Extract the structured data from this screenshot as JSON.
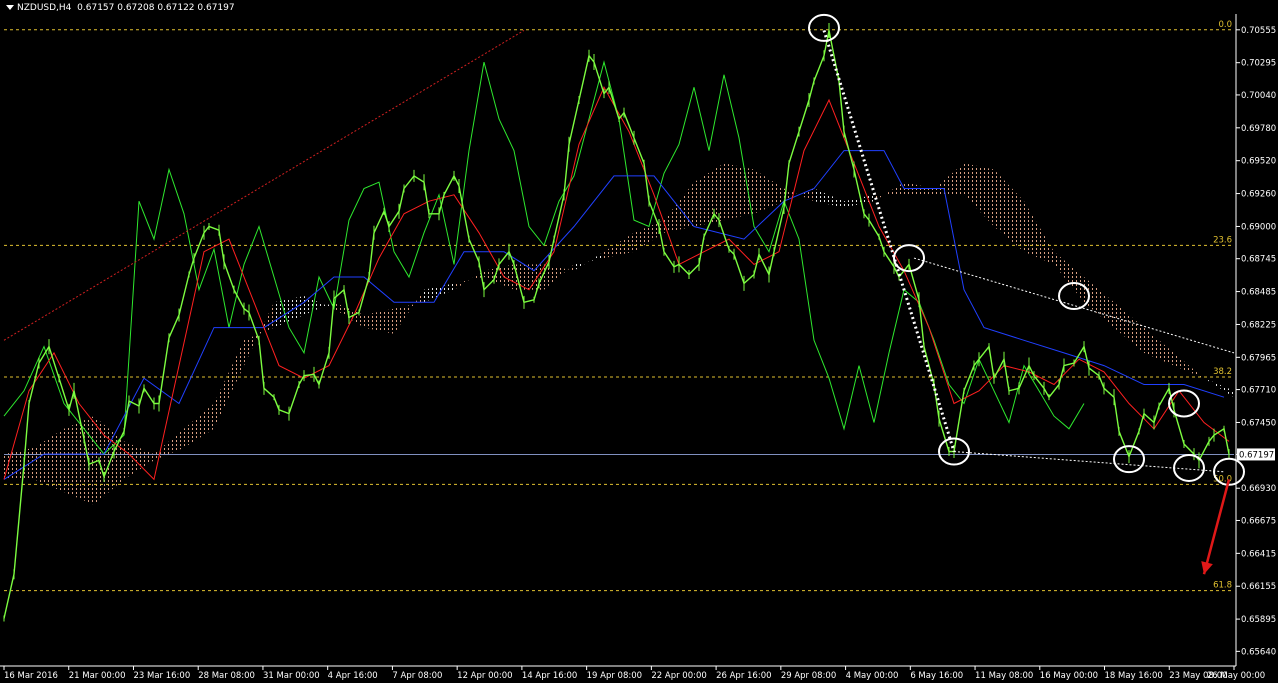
{
  "header": {
    "symbol_timeframe": "NZDUSD,H4",
    "ohlc": "0.67157 0.67208 0.67122 0.67197"
  },
  "colors": {
    "background": "#000000",
    "price_line": "#7cfc40",
    "chikou": "#2ee82e",
    "tenkan": "#ff2020",
    "kijun": "#2040ff",
    "fib_level": "#e0c030",
    "trendline": "#d02020",
    "annotation": "#ffffff",
    "cloud_bull": "#f0b090",
    "cloud_bear": "#ffffff",
    "current_price_line": "#8090c0",
    "arrow": "#e01818"
  },
  "chart_data": {
    "type": "line",
    "title": "",
    "xlabel": "",
    "ylabel": "",
    "ylim": [
      0.6554,
      0.7068
    ],
    "x_ticks": [
      "16 Mar 2016",
      "21 Mar 00:00",
      "23 Mar 16:00",
      "28 Mar 08:00",
      "31 Mar 00:00",
      "4 Apr 16:00",
      "7 Apr 08:00",
      "12 Apr 00:00",
      "14 Apr 16:00",
      "19 Apr 08:00",
      "22 Apr 00:00",
      "26 Apr 16:00",
      "29 Apr 08:00",
      "4 May 00:00",
      "6 May 16:00",
      "11 May 08:00",
      "16 May 00:00",
      "18 May 16:00",
      "23 May 08:00",
      "26 May 00:00"
    ],
    "y_ticks": [
      "0.70555",
      "0.70295",
      "0.70040",
      "0.69780",
      "0.69520",
      "0.69260",
      "0.69000",
      "0.68745",
      "0.68485",
      "0.68225",
      "0.67965",
      "0.67710",
      "0.67450",
      "0.67197",
      "0.66930",
      "0.66675",
      "0.66415",
      "0.66155",
      "0.65895",
      "0.65640"
    ],
    "current_price": 0.67197,
    "current_price_label": "0.67197",
    "fibonacci": [
      {
        "label": "0.0",
        "price": 0.70555
      },
      {
        "label": "23.6",
        "price": 0.6885
      },
      {
        "label": "38.2",
        "price": 0.6781
      },
      {
        "label": "50.0",
        "price": 0.6696
      },
      {
        "label": "61.8",
        "price": 0.6612
      }
    ],
    "price_path": [
      [
        0,
        0.659
      ],
      [
        2,
        0.6625
      ],
      [
        4,
        0.6712
      ],
      [
        5,
        0.676
      ],
      [
        7,
        0.6792
      ],
      [
        9,
        0.6805
      ],
      [
        11,
        0.678
      ],
      [
        13,
        0.6755
      ],
      [
        14,
        0.677
      ],
      [
        16,
        0.6732
      ],
      [
        17,
        0.6712
      ],
      [
        19,
        0.6715
      ],
      [
        20,
        0.6702
      ],
      [
        22,
        0.6722
      ],
      [
        24,
        0.6738
      ],
      [
        25,
        0.6762
      ],
      [
        27,
        0.6758
      ],
      [
        28,
        0.6772
      ],
      [
        30,
        0.676
      ],
      [
        31,
        0.676
      ],
      [
        33,
        0.6812
      ],
      [
        35,
        0.683
      ],
      [
        37,
        0.6862
      ],
      [
        38,
        0.6875
      ],
      [
        40,
        0.6895
      ],
      [
        41,
        0.69
      ],
      [
        43,
        0.6897
      ],
      [
        44,
        0.6872
      ],
      [
        46,
        0.685
      ],
      [
        48,
        0.6835
      ],
      [
        49,
        0.6832
      ],
      [
        51,
        0.681
      ],
      [
        52,
        0.6772
      ],
      [
        54,
        0.6765
      ],
      [
        55,
        0.6755
      ],
      [
        57,
        0.6752
      ],
      [
        59,
        0.6775
      ],
      [
        60,
        0.6782
      ],
      [
        62,
        0.6783
      ],
      [
        63,
        0.6775
      ],
      [
        65,
        0.68
      ],
      [
        66,
        0.6843
      ],
      [
        68,
        0.685
      ],
      [
        69,
        0.6828
      ],
      [
        71,
        0.6832
      ],
      [
        73,
        0.686
      ],
      [
        74,
        0.6895
      ],
      [
        76,
        0.6912
      ],
      [
        77,
        0.69
      ],
      [
        79,
        0.6912
      ],
      [
        80,
        0.693
      ],
      [
        82,
        0.694
      ],
      [
        84,
        0.6935
      ],
      [
        85,
        0.691
      ],
      [
        87,
        0.691
      ],
      [
        88,
        0.6925
      ],
      [
        90,
        0.694
      ],
      [
        91,
        0.6932
      ],
      [
        93,
        0.689
      ],
      [
        95,
        0.6872
      ],
      [
        96,
        0.685
      ],
      [
        98,
        0.6858
      ],
      [
        99,
        0.687
      ],
      [
        101,
        0.688
      ],
      [
        102,
        0.687
      ],
      [
        104,
        0.684
      ],
      [
        106,
        0.6842
      ],
      [
        107,
        0.6855
      ],
      [
        109,
        0.6872
      ],
      [
        110,
        0.689
      ],
      [
        112,
        0.6925
      ],
      [
        113,
        0.6965
      ],
      [
        115,
        0.7
      ],
      [
        117,
        0.7035
      ],
      [
        118,
        0.703
      ],
      [
        120,
        0.7005
      ],
      [
        121,
        0.701
      ],
      [
        123,
        0.6985
      ],
      [
        124,
        0.699
      ],
      [
        126,
        0.697
      ],
      [
        128,
        0.695
      ],
      [
        129,
        0.692
      ],
      [
        131,
        0.69
      ],
      [
        132,
        0.688
      ],
      [
        134,
        0.6868
      ],
      [
        135,
        0.687
      ],
      [
        137,
        0.6862
      ],
      [
        139,
        0.687
      ],
      [
        140,
        0.6892
      ],
      [
        142,
        0.691
      ],
      [
        143,
        0.6905
      ],
      [
        145,
        0.6882
      ],
      [
        146,
        0.6878
      ],
      [
        148,
        0.6855
      ],
      [
        150,
        0.6862
      ],
      [
        151,
        0.6878
      ],
      [
        153,
        0.6862
      ],
      [
        154,
        0.688
      ],
      [
        156,
        0.6915
      ],
      [
        157,
        0.695
      ],
      [
        159,
        0.6975
      ],
      [
        161,
        0.7
      ],
      [
        162,
        0.7015
      ],
      [
        164,
        0.7035
      ],
      [
        165,
        0.7055
      ],
      [
        167,
        0.7015
      ],
      [
        168,
        0.6975
      ],
      [
        170,
        0.6945
      ],
      [
        172,
        0.691
      ],
      [
        173,
        0.6905
      ],
      [
        175,
        0.6892
      ],
      [
        176,
        0.688
      ],
      [
        178,
        0.6868
      ],
      [
        179,
        0.686
      ],
      [
        181,
        0.687
      ],
      [
        183,
        0.6842
      ],
      [
        184,
        0.6805
      ],
      [
        186,
        0.6775
      ],
      [
        187,
        0.6748
      ],
      [
        189,
        0.6722
      ],
      [
        190,
        0.6722
      ],
      [
        192,
        0.677
      ],
      [
        194,
        0.679
      ],
      [
        195,
        0.6795
      ],
      [
        197,
        0.6805
      ],
      [
        198,
        0.678
      ],
      [
        200,
        0.6795
      ],
      [
        201,
        0.677
      ],
      [
        203,
        0.6772
      ],
      [
        205,
        0.679
      ],
      [
        206,
        0.6782
      ],
      [
        208,
        0.6772
      ],
      [
        209,
        0.6765
      ],
      [
        211,
        0.6775
      ],
      [
        212,
        0.679
      ],
      [
        214,
        0.6792
      ],
      [
        216,
        0.6805
      ],
      [
        217,
        0.6788
      ],
      [
        219,
        0.6782
      ],
      [
        220,
        0.6772
      ],
      [
        222,
        0.6765
      ],
      [
        223,
        0.6738
      ],
      [
        225,
        0.6718
      ],
      [
        227,
        0.6738
      ],
      [
        228,
        0.6752
      ],
      [
        230,
        0.6745
      ],
      [
        231,
        0.6758
      ],
      [
        233,
        0.6772
      ],
      [
        234,
        0.6755
      ],
      [
        236,
        0.6728
      ],
      [
        238,
        0.672
      ],
      [
        239,
        0.6715
      ],
      [
        241,
        0.673
      ],
      [
        242,
        0.6735
      ],
      [
        244,
        0.674
      ],
      [
        245,
        0.672
      ]
    ],
    "tenkan": [
      [
        0,
        0.67
      ],
      [
        5,
        0.677
      ],
      [
        10,
        0.68
      ],
      [
        15,
        0.676
      ],
      [
        20,
        0.6735
      ],
      [
        25,
        0.672
      ],
      [
        30,
        0.67
      ],
      [
        35,
        0.679
      ],
      [
        40,
        0.688
      ],
      [
        45,
        0.689
      ],
      [
        50,
        0.684
      ],
      [
        55,
        0.679
      ],
      [
        60,
        0.678
      ],
      [
        65,
        0.679
      ],
      [
        70,
        0.683
      ],
      [
        75,
        0.6875
      ],
      [
        80,
        0.691
      ],
      [
        85,
        0.692
      ],
      [
        90,
        0.6925
      ],
      [
        95,
        0.6895
      ],
      [
        100,
        0.686
      ],
      [
        105,
        0.685
      ],
      [
        110,
        0.688
      ],
      [
        115,
        0.6965
      ],
      [
        120,
        0.701
      ],
      [
        125,
        0.6975
      ],
      [
        130,
        0.6925
      ],
      [
        135,
        0.687
      ],
      [
        140,
        0.688
      ],
      [
        145,
        0.689
      ],
      [
        150,
        0.687
      ],
      [
        155,
        0.688
      ],
      [
        160,
        0.696
      ],
      [
        165,
        0.7
      ],
      [
        170,
        0.695
      ],
      [
        175,
        0.69
      ],
      [
        180,
        0.6865
      ],
      [
        185,
        0.682
      ],
      [
        190,
        0.676
      ],
      [
        195,
        0.677
      ],
      [
        200,
        0.679
      ],
      [
        205,
        0.6785
      ],
      [
        210,
        0.6775
      ],
      [
        215,
        0.6795
      ],
      [
        220,
        0.6785
      ],
      [
        225,
        0.676
      ],
      [
        230,
        0.674
      ],
      [
        235,
        0.677
      ],
      [
        240,
        0.6745
      ],
      [
        245,
        0.673
      ]
    ],
    "kijun": [
      [
        0,
        0.67
      ],
      [
        8,
        0.672
      ],
      [
        20,
        0.672
      ],
      [
        28,
        0.678
      ],
      [
        35,
        0.676
      ],
      [
        42,
        0.682
      ],
      [
        52,
        0.682
      ],
      [
        60,
        0.684
      ],
      [
        66,
        0.686
      ],
      [
        72,
        0.686
      ],
      [
        78,
        0.684
      ],
      [
        86,
        0.684
      ],
      [
        92,
        0.688
      ],
      [
        100,
        0.688
      ],
      [
        106,
        0.6865
      ],
      [
        114,
        0.69
      ],
      [
        122,
        0.694
      ],
      [
        130,
        0.694
      ],
      [
        138,
        0.69
      ],
      [
        148,
        0.689
      ],
      [
        156,
        0.692
      ],
      [
        162,
        0.693
      ],
      [
        168,
        0.696
      ],
      [
        176,
        0.696
      ],
      [
        180,
        0.693
      ],
      [
        188,
        0.693
      ],
      [
        192,
        0.685
      ],
      [
        196,
        0.682
      ],
      [
        204,
        0.681
      ],
      [
        212,
        0.68
      ],
      [
        220,
        0.679
      ],
      [
        228,
        0.6775
      ],
      [
        236,
        0.6775
      ],
      [
        244,
        0.6765
      ]
    ],
    "chikou": [
      [
        0,
        0.675
      ],
      [
        4,
        0.677
      ],
      [
        8,
        0.6805
      ],
      [
        12,
        0.676
      ],
      [
        16,
        0.674
      ],
      [
        20,
        0.672
      ],
      [
        24,
        0.6735
      ],
      [
        27,
        0.692
      ],
      [
        30,
        0.689
      ],
      [
        33,
        0.6945
      ],
      [
        36,
        0.691
      ],
      [
        39,
        0.685
      ],
      [
        42,
        0.6882
      ],
      [
        45,
        0.682
      ],
      [
        48,
        0.687
      ],
      [
        51,
        0.69
      ],
      [
        54,
        0.686
      ],
      [
        57,
        0.682
      ],
      [
        60,
        0.68
      ],
      [
        63,
        0.686
      ],
      [
        66,
        0.6835
      ],
      [
        69,
        0.6905
      ],
      [
        72,
        0.693
      ],
      [
        75,
        0.6935
      ],
      [
        78,
        0.688
      ],
      [
        81,
        0.686
      ],
      [
        84,
        0.6895
      ],
      [
        87,
        0.6925
      ],
      [
        90,
        0.687
      ],
      [
        93,
        0.696
      ],
      [
        96,
        0.703
      ],
      [
        99,
        0.6985
      ],
      [
        102,
        0.696
      ],
      [
        105,
        0.69
      ],
      [
        108,
        0.6885
      ],
      [
        111,
        0.692
      ],
      [
        114,
        0.694
      ],
      [
        117,
        0.6985
      ],
      [
        120,
        0.703
      ],
      [
        123,
        0.6985
      ],
      [
        126,
        0.6905
      ],
      [
        129,
        0.69
      ],
      [
        132,
        0.6942
      ],
      [
        135,
        0.6965
      ],
      [
        138,
        0.701
      ],
      [
        141,
        0.696
      ],
      [
        144,
        0.702
      ],
      [
        147,
        0.697
      ],
      [
        150,
        0.69
      ],
      [
        153,
        0.688
      ],
      [
        156,
        0.692
      ],
      [
        159,
        0.689
      ],
      [
        162,
        0.681
      ],
      [
        165,
        0.678
      ],
      [
        168,
        0.674
      ],
      [
        171,
        0.679
      ],
      [
        174,
        0.6745
      ],
      [
        177,
        0.68
      ],
      [
        180,
        0.685
      ],
      [
        183,
        0.684
      ],
      [
        186,
        0.681
      ],
      [
        189,
        0.6775
      ],
      [
        192,
        0.676
      ],
      [
        195,
        0.6795
      ],
      [
        198,
        0.677
      ],
      [
        201,
        0.6745
      ],
      [
        204,
        0.679
      ],
      [
        207,
        0.677
      ],
      [
        210,
        0.675
      ],
      [
        213,
        0.674
      ],
      [
        216,
        0.676
      ]
    ],
    "cloud": [
      {
        "x": [
          0,
          6,
          12,
          18,
          24,
          30,
          36,
          42,
          48,
          54,
          60,
          66,
          72,
          78,
          84,
          90,
          96,
          102,
          108,
          114,
          120,
          126,
          132,
          138,
          144,
          150,
          156,
          162,
          168,
          174,
          180,
          186,
          192,
          198,
          204,
          210,
          216,
          222,
          228,
          234,
          240,
          246
        ],
        "span_a": [
          0.672,
          0.6725,
          0.674,
          0.675,
          0.673,
          0.672,
          0.674,
          0.676,
          0.681,
          0.682,
          0.683,
          0.684,
          0.683,
          0.6835,
          0.684,
          0.685,
          0.6865,
          0.687,
          0.687,
          0.6865,
          0.688,
          0.6895,
          0.6905,
          0.6935,
          0.695,
          0.6945,
          0.693,
          0.692,
          0.6915,
          0.692,
          0.6935,
          0.693,
          0.695,
          0.6945,
          0.692,
          0.688,
          0.686,
          0.684,
          0.682,
          0.68,
          0.678,
          0.6765
        ],
        "span_b": [
          0.67,
          0.67,
          0.669,
          0.668,
          0.67,
          0.6715,
          0.6725,
          0.674,
          0.679,
          0.684,
          0.6845,
          0.6835,
          0.682,
          0.6815,
          0.685,
          0.6855,
          0.686,
          0.685,
          0.685,
          0.687,
          0.6875,
          0.688,
          0.6895,
          0.69,
          0.6905,
          0.691,
          0.692,
          0.693,
          0.692,
          0.6925,
          0.6925,
          0.6925,
          0.6925,
          0.69,
          0.688,
          0.687,
          0.684,
          0.682,
          0.68,
          0.679,
          0.678,
          0.677
        ]
      }
    ],
    "annotations": {
      "rising_trendline": {
        "from": [
          0,
          0.681
        ],
        "to": [
          104,
          0.7055
        ]
      },
      "swing_dotted_line": {
        "from": [
          164,
          0.7055
        ],
        "to": [
          190,
          0.6722
        ]
      },
      "descending_dotted_line": {
        "from": [
          182,
          0.6875
        ],
        "to": [
          246,
          0.68
        ]
      },
      "support_dotted_line": {
        "from": [
          190,
          0.6722
        ],
        "to": [
          244,
          0.6706
        ]
      },
      "circles": [
        {
          "x": 164,
          "price": 0.7057
        },
        {
          "x": 181,
          "price": 0.6875
        },
        {
          "x": 190,
          "price": 0.6722
        },
        {
          "x": 214,
          "price": 0.6845
        },
        {
          "x": 225,
          "price": 0.6716
        },
        {
          "x": 236,
          "price": 0.676
        },
        {
          "x": 237,
          "price": 0.6709
        },
        {
          "x": 245,
          "price": 0.6706
        }
      ],
      "arrow": {
        "from": [
          245,
          0.67
        ],
        "to": [
          240,
          0.6625
        ]
      }
    }
  }
}
